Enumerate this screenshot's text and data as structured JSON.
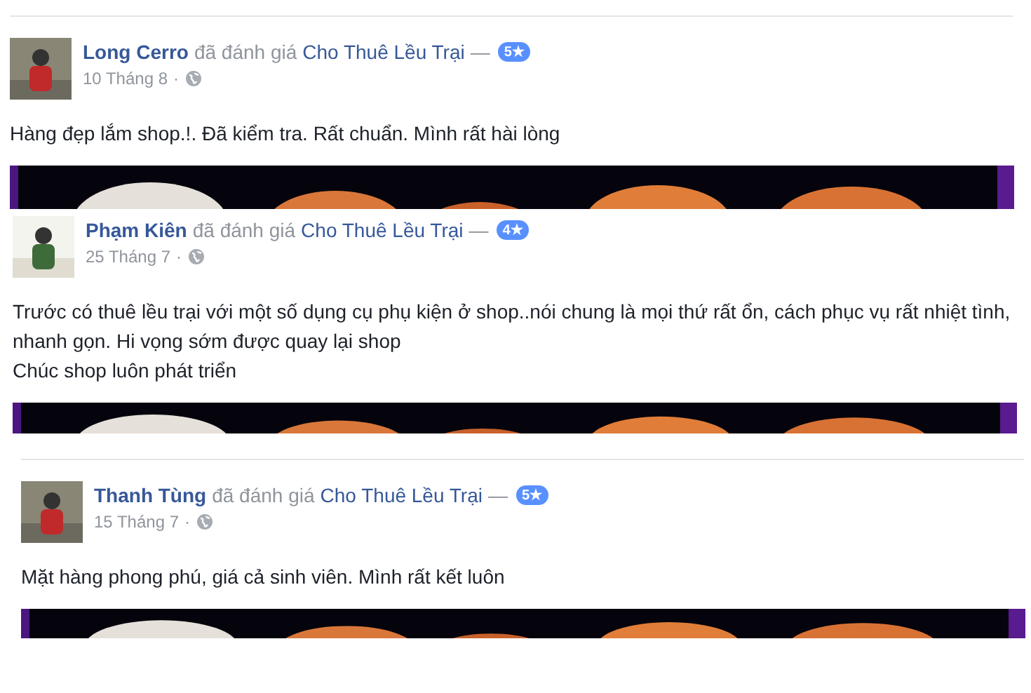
{
  "reviews": [
    {
      "author": "Long Cerro",
      "verb": "đã đánh giá",
      "page": "Cho Thuê Lều Trại",
      "dash": "—",
      "rating": "5★",
      "date": "10 Tháng 8",
      "separator": "·",
      "text": [
        "Hàng đẹp lắm shop.!. Đã kiểm tra. Rất chuẩn. Mình rất hài lòng"
      ],
      "photo": {
        "kind": "picture"
      }
    },
    {
      "author": "Phạm Kiên",
      "verb": "đã đánh giá",
      "page": "Cho Thuê Lều Trại",
      "dash": "—",
      "rating": "4★",
      "date": "25 Tháng 7",
      "separator": "·",
      "text": [
        "Trước có thuê lều trại với một số dụng cụ phụ kiện ở shop..nói chung là mọi thứ rất ổn, cách phục vụ rất nhiệt tình, nhanh gọn. Hi vọng sớm được quay lại shop",
        "Chúc shop luôn phát triển"
      ],
      "photo": {
        "kind": "picture"
      }
    },
    {
      "author": "Thanh Tùng",
      "verb": "đã đánh giá",
      "page": "Cho Thuê Lều Trại",
      "dash": "—",
      "rating": "5★",
      "date": "15 Tháng 7",
      "separator": "·",
      "text": [
        "Mặt hàng phong phú, giá cả sinh viên. Mình rất kết luôn"
      ],
      "photo": {
        "kind": "picture"
      }
    }
  ]
}
